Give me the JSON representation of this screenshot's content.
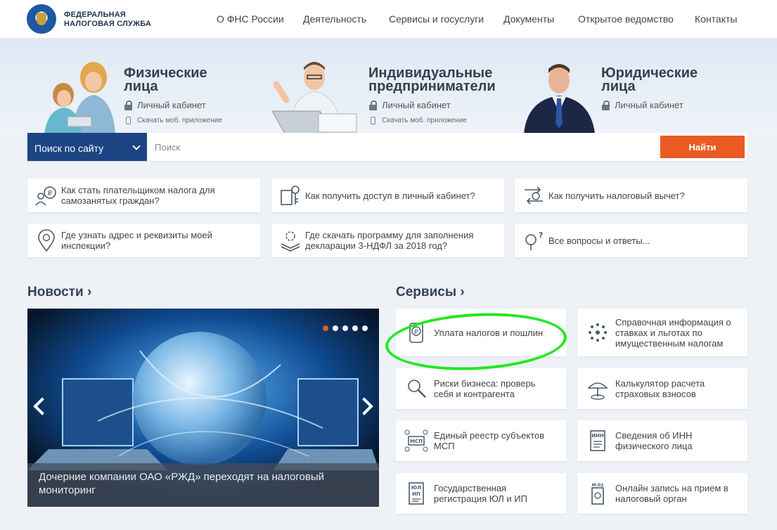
{
  "header": {
    "logo_line1": "ФЕДЕРАЛЬНАЯ",
    "logo_line2": "НАЛОГОВАЯ СЛУЖБА",
    "nav": [
      "О ФНС России",
      "Деятельность",
      "Сервисы и госуслуги",
      "Документы",
      "Открытое ведомство",
      "Контакты"
    ]
  },
  "hero": {
    "segments": [
      {
        "title_line1": "Физические",
        "title_line2": "лица",
        "cabinet": "Личный кабинет",
        "app": "Скачать моб. приложение"
      },
      {
        "title_line1": "Индивидуальные",
        "title_line2": "предприниматели",
        "cabinet": "Личный кабинет",
        "app": "Скачать моб. приложение"
      },
      {
        "title_line1": "Юридические",
        "title_line2": "лица",
        "cabinet": "Личный кабинет"
      }
    ]
  },
  "search": {
    "scope": "Поиск по сайту",
    "placeholder": "Поиск",
    "button": "Найти"
  },
  "quick_links": [
    {
      "line1": "Как стать плательщиком налога для",
      "line2": "самозанятых граждан?",
      "icon": "self-employed-icon"
    },
    {
      "line1": "Как получить доступ в личный кабинет?",
      "line2": "",
      "icon": "key-access-icon"
    },
    {
      "line1": "Как получить налоговый вычет?",
      "line2": "",
      "icon": "tax-deduction-icon"
    },
    {
      "line1": "Где узнать адрес и реквизиты моей",
      "line2": "инспекции?",
      "icon": "location-pin-icon"
    },
    {
      "line1": "Где скачать программу для заполнения",
      "line2": "декларации 3-НДФЛ за 2018 год?",
      "icon": "download-program-icon"
    },
    {
      "line1": "Все вопросы и ответы...",
      "line2": "",
      "icon": "question-icon"
    }
  ],
  "news": {
    "title": "Новости",
    "caption_line1": "Дочерние компании ОАО «РЖД» переходят на налоговый",
    "caption_line2": "мониторинг",
    "slides": 5,
    "active_slide": 1
  },
  "services": {
    "title": "Сервисы",
    "items": [
      {
        "line1": "Уплата налогов и пошлин",
        "line2": "",
        "line3": "",
        "icon": "payment-icon"
      },
      {
        "line1": "Справочная информация о",
        "line2": "ставках и льготах по",
        "line3": "имущественным налогам",
        "icon": "reference-info-icon"
      },
      {
        "line1": "Риски бизнеса: проверь",
        "line2": "себя и контрагента",
        "line3": "",
        "icon": "business-risk-icon"
      },
      {
        "line1": "Калькулятор расчета",
        "line2": "страховых взносов",
        "line3": "",
        "icon": "calculator-icon"
      },
      {
        "line1": "Единый реестр субъектов",
        "line2": "МСП",
        "line3": "",
        "icon": "msp-registry-icon"
      },
      {
        "line1": "Сведения об ИНН",
        "line2": "физического лица",
        "line3": "",
        "icon": "inn-icon"
      },
      {
        "line1": "Государственная",
        "line2": "регистрация ЮЛ и ИП",
        "line3": "",
        "icon": "registration-icon"
      },
      {
        "line1": "Онлайн запись на прием в",
        "line2": "налоговый орган",
        "line3": "",
        "icon": "appointment-icon"
      }
    ],
    "icon_labels": {
      "msp": "МСП",
      "inn": "ИНН",
      "ul": "ЮЛ",
      "ip": "ИП",
      "m02": "М-02",
      "rub": "₽"
    }
  },
  "colors": {
    "brand_blue": "#1d4583",
    "accent_orange": "#ea5b23",
    "highlight_green": "#21e821"
  }
}
